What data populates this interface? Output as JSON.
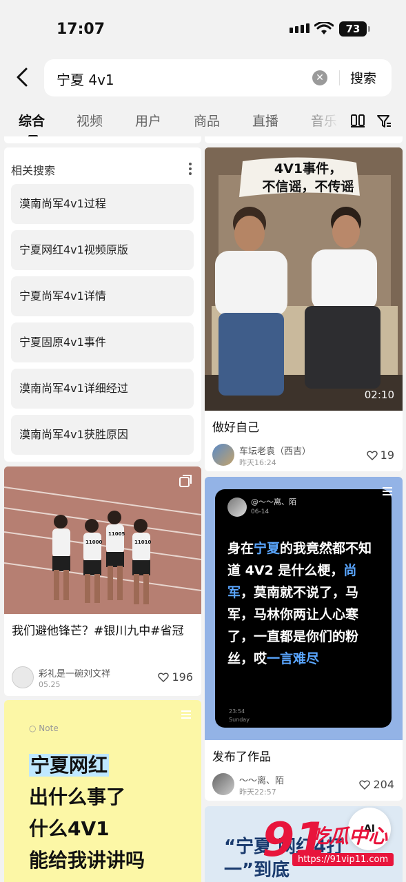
{
  "status_bar": {
    "time": "17:07",
    "battery": "73"
  },
  "search": {
    "query": "宁夏 4v1",
    "button_label": "搜索"
  },
  "tabs": [
    {
      "label": "综合",
      "active": true
    },
    {
      "label": "视频"
    },
    {
      "label": "用户"
    },
    {
      "label": "商品"
    },
    {
      "label": "直播"
    },
    {
      "label": "音乐"
    }
  ],
  "related": {
    "title": "相关搜索",
    "items": [
      "漠南尚军4v1过程",
      "宁夏网红4v1视频原版",
      "宁夏尚军4v1详情",
      "宁夏固原4v1事件",
      "漠南尚军4v1详细经过",
      "漠南尚军4v1获胜原因"
    ]
  },
  "cards": [
    {
      "overlay_line1": "4V1事件，",
      "overlay_line2": "不信谣，不传谣",
      "duration": "02:10",
      "caption": "做好自己",
      "author": "车坛老袁（西吉）",
      "date": "昨天16:24",
      "likes": "19"
    },
    {
      "caption": "我们避他锋芒？#银川九中#省冠",
      "author": "彩礼是一碗刘文祥",
      "date": "05.25",
      "likes": "196",
      "bibs": [
        "11000",
        "11005",
        "11010"
      ]
    },
    {
      "post_user": "@～～离、陌",
      "post_date": "06-14",
      "post_text_parts": [
        "身在",
        "宁夏",
        "的我竟然都不知道 4V2 是什么梗，",
        "尚军",
        "，莫南就不说了，马军，马林你两让人心寒了，一直都是你们的粉丝，哎",
        "一言难尽"
      ],
      "post_time": "23:54",
      "post_day": "Sunday",
      "caption": "发布了作品",
      "author": "～～离、陌",
      "date": "昨天22:57",
      "likes": "204"
    },
    {
      "note_label": "Note",
      "lines": [
        "宁夏网红",
        "出什么事了",
        "什么4V1",
        "能给我讲讲吗"
      ]
    },
    {
      "partial_text": "“宁夏 网红4打一”到底"
    }
  ],
  "watermark": {
    "brand": "91",
    "text": "吃瓜中心",
    "url": "https://91vip11.com"
  },
  "ai_button": "AI"
}
